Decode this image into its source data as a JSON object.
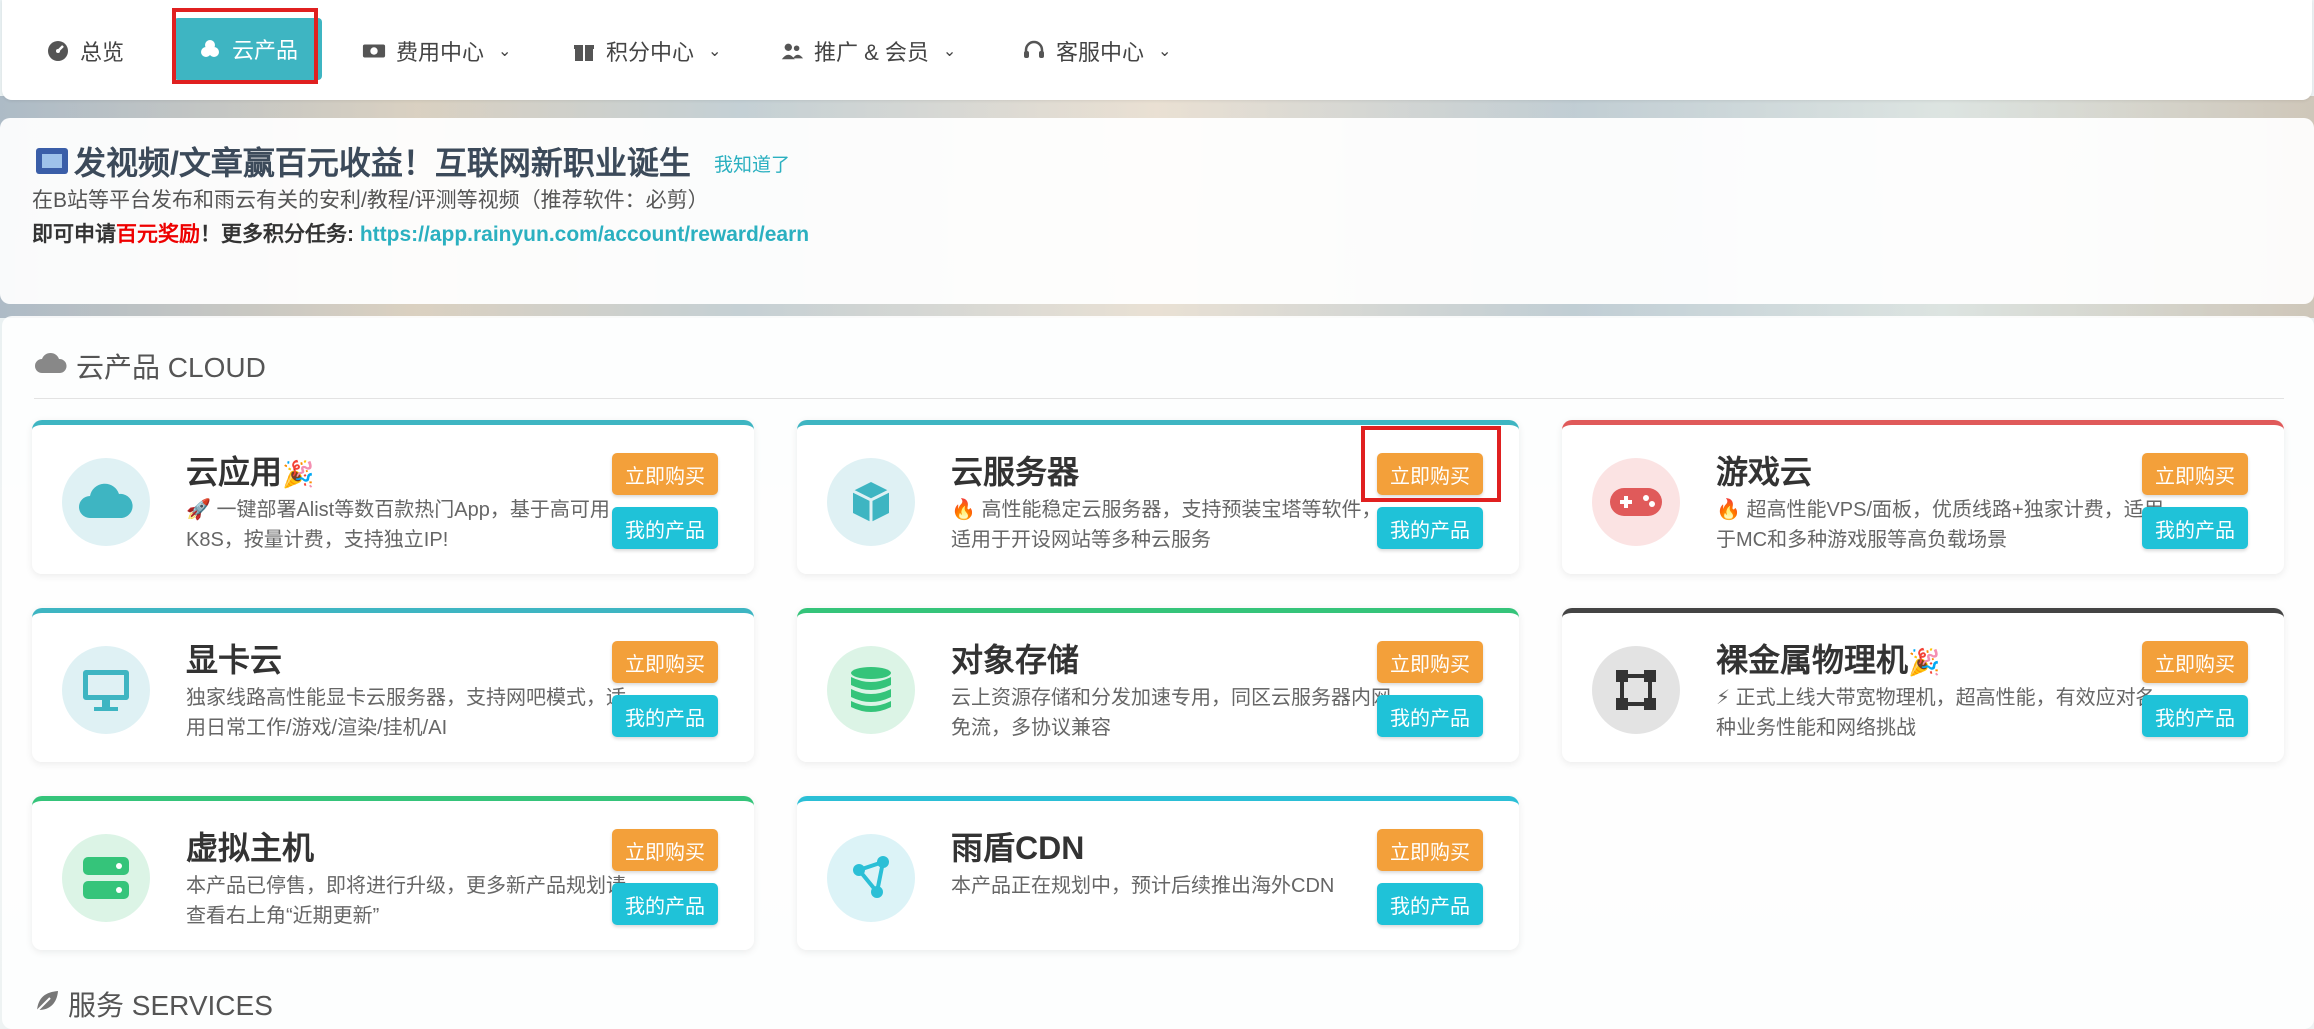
{
  "nav": {
    "items": [
      {
        "label": "总览",
        "icon": "dashboard-icon",
        "dropdown": false,
        "active": false
      },
      {
        "label": "云产品",
        "icon": "cubes-icon",
        "dropdown": false,
        "active": true
      },
      {
        "label": "费用中心",
        "icon": "money-icon",
        "dropdown": true,
        "active": false
      },
      {
        "label": "积分中心",
        "icon": "gift-icon",
        "dropdown": true,
        "active": false
      },
      {
        "label": "推广 & 会员",
        "icon": "users-icon",
        "dropdown": true,
        "active": false
      },
      {
        "label": "客服中心",
        "icon": "headset-icon",
        "dropdown": true,
        "active": false
      }
    ]
  },
  "announcement": {
    "title": "发视频/文章赢百元收益！互联网新职业诞生",
    "dismiss": "我知道了",
    "line1": "在B站等平台发布和雨云有关的安利/教程/评测等视频（推荐软件：必剪）",
    "line2_prefix": "即可申请",
    "line2_highlight": "百元奖励",
    "line2_mid": "！更多积分任务: ",
    "line2_url": "https://app.rainyun.com/account/reward/earn"
  },
  "section_cloud": {
    "title": "云产品 CLOUD"
  },
  "section_services": {
    "title": "服务 SERVICES"
  },
  "buttons": {
    "buy": "立即购买",
    "mine": "我的产品"
  },
  "products": [
    {
      "title": "云应用",
      "emoji": "🎉",
      "desc": "🚀 一键部署Alist等数百款热门App，基于高可用K8S，按量计费，支持独立IP!",
      "icon": "cloud-icon",
      "accent": "#3eb5c2"
    },
    {
      "title": "云服务器",
      "emoji": "",
      "desc": "🔥 高性能稳定云服务器，支持预装宝塔等软件，适用于开设网站等多种云服务",
      "icon": "cube-icon",
      "accent": "#3eb5c2"
    },
    {
      "title": "游戏云",
      "emoji": "",
      "desc": "🔥 超高性能VPS/面板，优质线路+独家计费，适用于MC和多种游戏服等高负载场景",
      "icon": "gamepad-icon",
      "accent": "#e05a5a"
    },
    {
      "title": "显卡云",
      "emoji": "",
      "desc": "独家线路高性能显卡云服务器，支持网吧模式，适用日常工作/游戏/渲染/挂机/AI",
      "icon": "monitor-icon",
      "accent": "#3eb5c2"
    },
    {
      "title": "对象存储",
      "emoji": "",
      "desc": "云上资源存储和分发加速专用，同区云服务器内网免流，多协议兼容",
      "icon": "database-icon",
      "accent": "#35c47a"
    },
    {
      "title": "裸金属物理机",
      "emoji": "🎉",
      "desc": "⚡ 正式上线大带宽物理机，超高性能，有效应对各种业务性能和网络挑战",
      "icon": "vector-square-icon",
      "accent": "#444444"
    },
    {
      "title": "虚拟主机",
      "emoji": "",
      "desc": "本产品已停售，即将进行升级，更多新产品规划请查看右上角“近期更新”",
      "icon": "server-icon",
      "accent": "#35c47a"
    },
    {
      "title": "雨盾CDN",
      "emoji": "",
      "desc": "本产品正在规划中，预计后续推出海外CDN",
      "icon": "share-nodes-icon",
      "accent": "#2bbfd6"
    }
  ]
}
